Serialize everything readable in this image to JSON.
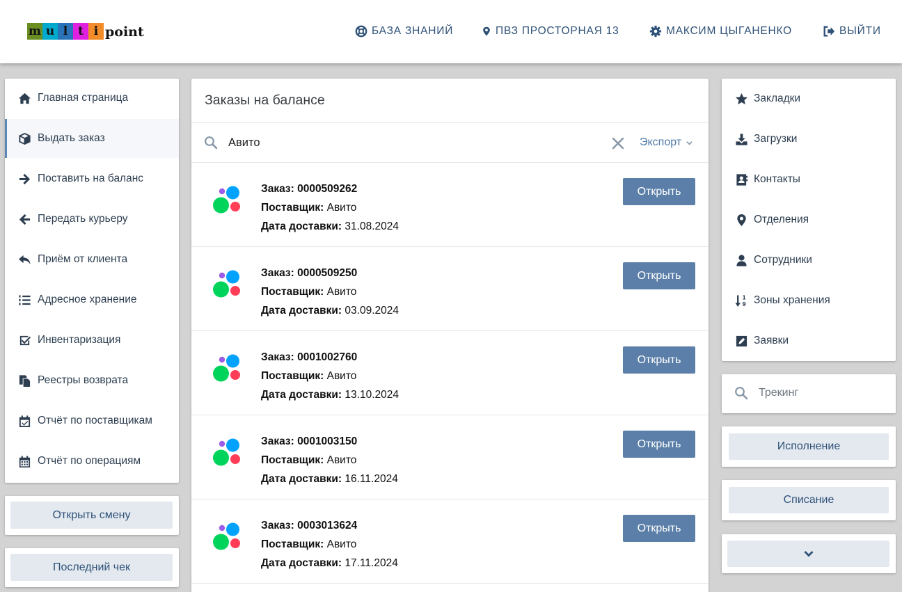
{
  "header": {
    "logo_letters": [
      "m",
      "u",
      "l",
      "t",
      "i"
    ],
    "logo_colors": [
      "#6b8e23",
      "#00aacc",
      "#2a73b8",
      "#e020e0",
      "#f28c28"
    ],
    "logo_rest": "point",
    "nav": {
      "knowledge_base": "БАЗА ЗНАНИЙ",
      "pickup_point": "ПВЗ ПРОСТОРНАЯ 13",
      "user": "МАКСИМ ЦЫГАНЕНКО",
      "logout": "ВЫЙТИ"
    }
  },
  "left_menu": {
    "items": [
      {
        "label": "Главная страница",
        "icon": "home-icon"
      },
      {
        "label": "Выдать заказ",
        "icon": "box-icon",
        "active": true
      },
      {
        "label": "Поставить на баланс",
        "icon": "arrow-right-icon"
      },
      {
        "label": "Передать курьеру",
        "icon": "arrow-left-icon"
      },
      {
        "label": "Приём от клиента",
        "icon": "reply-icon"
      },
      {
        "label": "Адресное хранение",
        "icon": "numbered-list-icon"
      },
      {
        "label": "Инвентаризация",
        "icon": "checkbox-icon"
      },
      {
        "label": "Реестры возврата",
        "icon": "copy-icon"
      },
      {
        "label": "Отчёт по поставщикам",
        "icon": "calendar-check-icon"
      },
      {
        "label": "Отчёт по операциям",
        "icon": "calendar-icon"
      }
    ],
    "open_shift": "Открыть смену",
    "last_receipt": "Последний чек"
  },
  "main": {
    "title": "Заказы на балансе",
    "search_value": "Авито",
    "export_label": "Экспорт",
    "labels": {
      "order": "Заказ:",
      "supplier": "Поставщик:",
      "delivery_date": "Дата доставки:"
    },
    "open_label": "Открыть",
    "orders": [
      {
        "number": "0000509262",
        "supplier": "Авито",
        "date": "31.08.2024"
      },
      {
        "number": "0000509250",
        "supplier": "Авито",
        "date": "03.09.2024"
      },
      {
        "number": "0001002760",
        "supplier": "Авито",
        "date": "13.10.2024"
      },
      {
        "number": "0001003150",
        "supplier": "Авито",
        "date": "16.11.2024"
      },
      {
        "number": "0003013624",
        "supplier": "Авито",
        "date": "17.11.2024"
      }
    ]
  },
  "right_menu": {
    "items": [
      {
        "label": "Закладки",
        "icon": "star-icon"
      },
      {
        "label": "Загрузки",
        "icon": "download-icon"
      },
      {
        "label": "Контакты",
        "icon": "address-book-icon"
      },
      {
        "label": "Отделения",
        "icon": "map-marker-icon"
      },
      {
        "label": "Сотрудники",
        "icon": "user-icon"
      },
      {
        "label": "Зоны хранения",
        "icon": "sort-numeric-icon"
      },
      {
        "label": "Заявки",
        "icon": "edit-icon"
      }
    ],
    "tracking_placeholder": "Трекинг",
    "execution": "Исполнение",
    "write_off": "Списание"
  },
  "colors": {
    "accent": "#5b7fa8",
    "nav_text": "#2f5278",
    "bubble_purple": "#9b5de5",
    "bubble_blue": "#00a2ff",
    "bubble_green": "#00d45a",
    "bubble_red": "#ff3d57"
  }
}
